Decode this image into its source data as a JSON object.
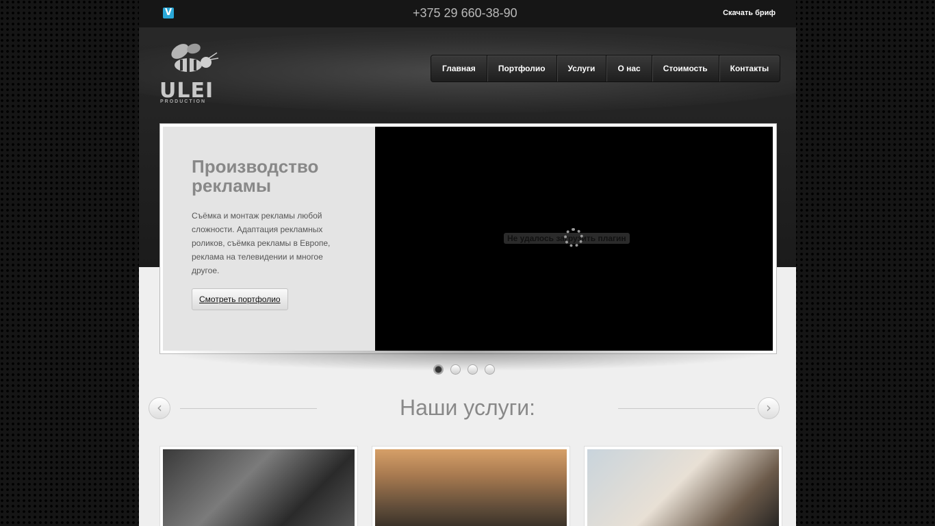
{
  "topbar": {
    "phone": "+375 29 660-38-90",
    "brief_label": "Скачать бриф",
    "vimeo_glyph": "V"
  },
  "logo": {
    "name": "ULEI",
    "sub": "PRODUCTION"
  },
  "nav": [
    "Главная",
    "Портфолио",
    "Услуги",
    "О нас",
    "Стоимость",
    "Контакты"
  ],
  "slide": {
    "title": "Производство рекламы",
    "text": "Съёмка и монтаж рекламы любой сложности. Адаптация рекламных роликов, съёмка рекламы в Европе, реклама на телевидении и многое другое.",
    "button": "Смотреть портфолио",
    "plugin_message": "Не удалось загрузить плагин"
  },
  "slider_dots": {
    "count": 4,
    "active": 1
  },
  "services": {
    "title": "Наши услуги:",
    "prev_glyph": "‹",
    "next_glyph": "›"
  }
}
